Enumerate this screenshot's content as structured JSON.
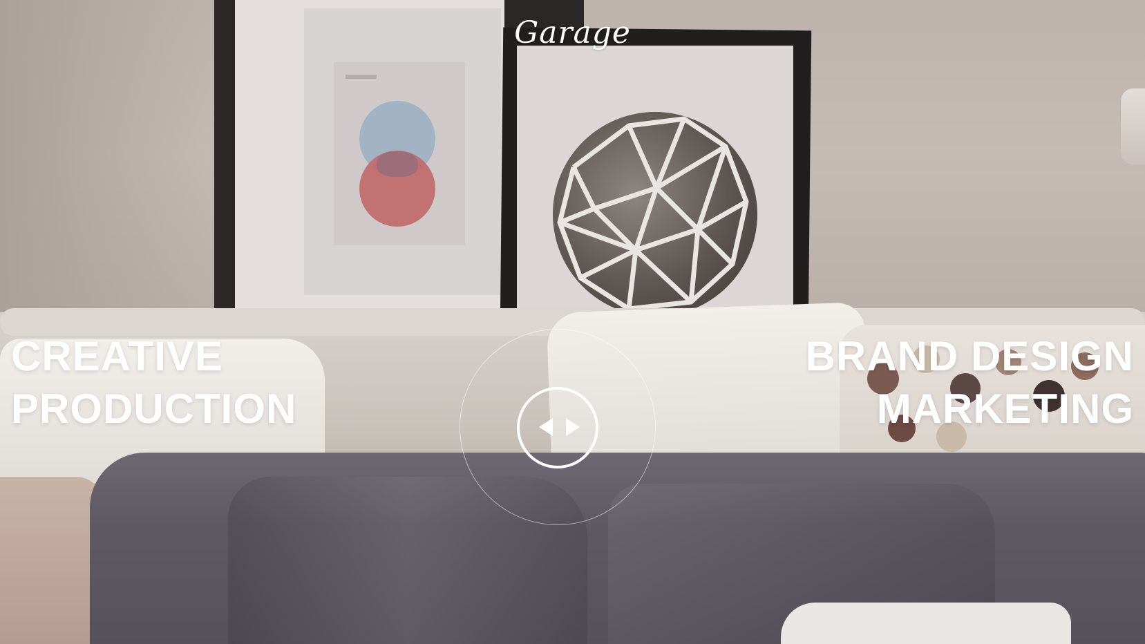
{
  "brand": {
    "logo_text": "Garage"
  },
  "hero": {
    "left_heading": {
      "line1": "CREATIVE",
      "line2": "PRODUCTION"
    },
    "right_heading": {
      "line1": "BRAND DESIGN",
      "line2": "MARKETING"
    }
  },
  "slider_control": {
    "icons": [
      "arrow-left-icon",
      "arrow-right-icon"
    ]
  },
  "colors": {
    "overlay_text": "#ffffff"
  }
}
